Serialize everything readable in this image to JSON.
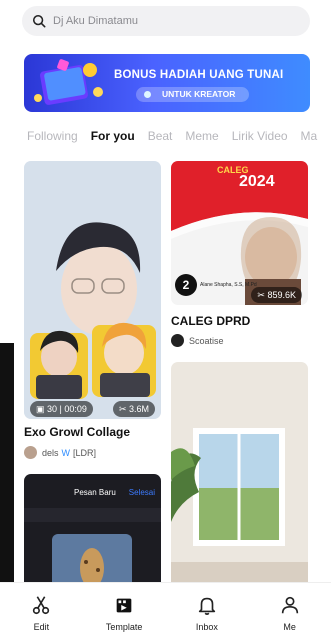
{
  "search": {
    "placeholder": "Dj Aku Dimatamu"
  },
  "banner": {
    "title": "BONUS HADIAH UANG TUNAI",
    "subtitle": "UNTUK KREATOR"
  },
  "tabs": [
    {
      "label": "Following",
      "active": false
    },
    {
      "label": "For you",
      "active": true
    },
    {
      "label": "Beat",
      "active": false
    },
    {
      "label": "Meme",
      "active": false
    },
    {
      "label": "Lirik Video",
      "active": false
    },
    {
      "label": "Ma",
      "active": false
    }
  ],
  "cards": [
    {
      "title": "Exo Growl Collage",
      "clips": "30",
      "duration": "00:09",
      "uses": "3.6M",
      "author": "dels",
      "author_suffix": "[LDR]"
    },
    {
      "title": "CALEG DPRD",
      "uses": "859.6K",
      "author": "Scoatise",
      "poster_heading": "CALEG",
      "poster_year": "2024",
      "poster_name": "Alane Shapha, S.S, M.Pd"
    },
    {
      "title": "",
      "header": "Pesan Baru",
      "header_action": "Selesai"
    },
    {
      "title": ""
    }
  ],
  "nav": [
    {
      "label": "Edit",
      "icon": "scissors-icon"
    },
    {
      "label": "Template",
      "icon": "clapperboard-icon"
    },
    {
      "label": "Inbox",
      "icon": "bell-icon"
    },
    {
      "label": "Me",
      "icon": "person-icon"
    }
  ],
  "colors": {
    "accent_blue": "#2b37d6",
    "caleg_red": "#e0202a"
  }
}
